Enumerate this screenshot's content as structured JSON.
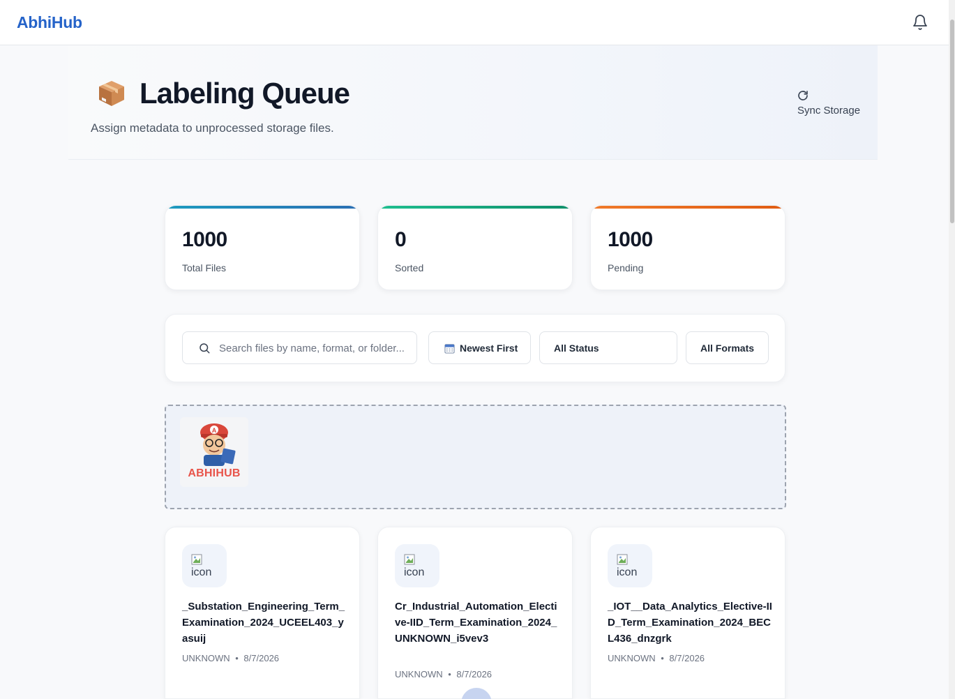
{
  "navbar": {
    "brand": "AbhiHub"
  },
  "header": {
    "title": "Labeling Queue",
    "subtitle": "Assign metadata to unprocessed storage files.",
    "sync_label": "Sync Storage"
  },
  "stats": [
    {
      "value": "1000",
      "label": "Total Files",
      "color": "#1d8fc2"
    },
    {
      "value": "0",
      "label": "Sorted",
      "color": "#10a37f"
    },
    {
      "value": "1000",
      "label": "Pending",
      "color": "#ea6a1c"
    }
  ],
  "filters": {
    "search_placeholder": "Search files by name, format, or folder...",
    "sort_label": "Newest First",
    "status_label": "All Status",
    "formats_label": "All Formats"
  },
  "dropzone": {
    "logo_text": "ABHIHUB"
  },
  "files": [
    {
      "name": "_Substation_Engineering_Term_Examination_2024_UCEEL403_yasuij",
      "icon_alt": "icon",
      "format": "UNKNOWN",
      "date": "8/7/2026"
    },
    {
      "name": "Cr_Industrial_Automation_Elective-IID_Term_Examination_2024_UNKNOWN_i5vev3",
      "icon_alt": "icon",
      "format": "UNKNOWN",
      "date": "8/7/2026"
    },
    {
      "name": "_IOT__Data_Analytics_Elective-IID_Term_Examination_2024_BECL436_dnzgrk",
      "icon_alt": "icon",
      "format": "UNKNOWN",
      "date": "8/7/2026"
    }
  ],
  "meta_separator": "•"
}
